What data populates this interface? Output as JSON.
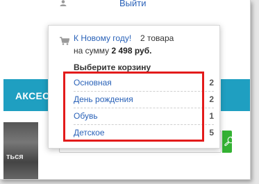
{
  "header": {
    "user_icon": "user-icon",
    "logout_label": "Выйти"
  },
  "background": {
    "category_tab_label": "АКСЕС",
    "banner_text": "ться",
    "search_button_icon": "search-icon"
  },
  "cart_popup": {
    "cart_icon": "cart-icon",
    "current_cart_name": "К Новому году!",
    "current_cart_count": "2 товара",
    "total_label": "на сумму",
    "total_value": "2 498 руб.",
    "choose_title": "Выберите корзину",
    "carts": [
      {
        "name": "Основная",
        "count": "2"
      },
      {
        "name": "День рождения",
        "count": "2"
      },
      {
        "name": "Обувь",
        "count": "1"
      },
      {
        "name": "Детское",
        "count": "5"
      }
    ]
  },
  "colors": {
    "link": "#2a62b8",
    "teal": "#1f9fc1",
    "green": "#34b233",
    "highlight": "#e31b1b"
  }
}
